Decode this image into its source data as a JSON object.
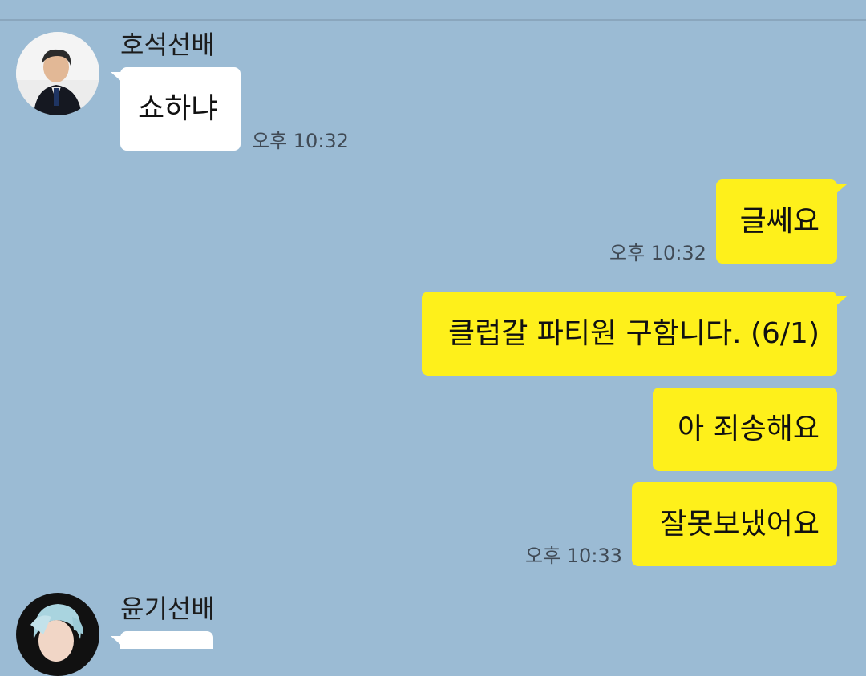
{
  "chat": {
    "messages": [
      {
        "sender": "호석선배",
        "text": "쇼하냐",
        "time": "오후 10:32",
        "direction": "incoming"
      },
      {
        "text": "글쎄요",
        "time": "오후 10:32",
        "direction": "outgoing"
      },
      {
        "text": "클럽갈 파티원 구함니다. (6/1)",
        "direction": "outgoing"
      },
      {
        "text": "아 죄송해요",
        "direction": "outgoing"
      },
      {
        "text": "잘못보냈어요",
        "time": "오후 10:33",
        "direction": "outgoing"
      },
      {
        "sender": "윤기선배",
        "text": "",
        "direction": "incoming"
      }
    ]
  },
  "colors": {
    "background": "#9bbbd4",
    "incoming_bubble": "#ffffff",
    "outgoing_bubble": "#fef01b"
  },
  "icons": {
    "avatar_1": "profile-photo",
    "avatar_2": "profile-photo"
  }
}
